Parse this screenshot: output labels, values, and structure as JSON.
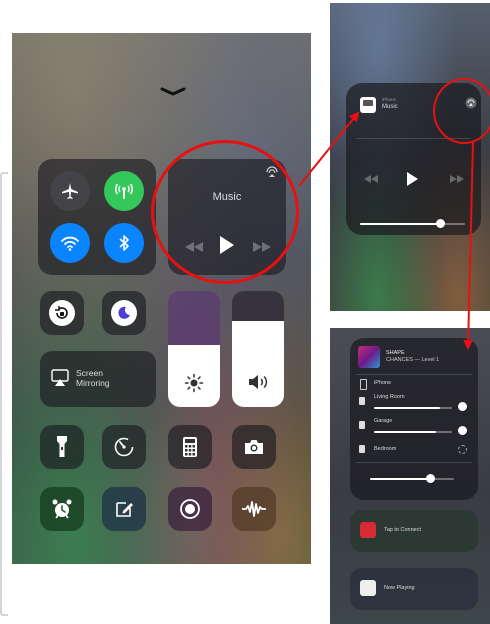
{
  "main": {
    "music_title": "Music",
    "screen_mirroring_label": "Screen\nMirroring"
  },
  "top_right": {
    "source_label": "iPhone",
    "track_label": "Music"
  },
  "bottom_right": {
    "track_title": "SHAPE",
    "track_artist": "CHANCES — Level 1",
    "devices": [
      {
        "name": "iPhone"
      },
      {
        "name": "Living Room"
      },
      {
        "name": "Garage"
      },
      {
        "name": "Bedroom"
      }
    ],
    "connect_label": "Tap to Connect",
    "now_playing_label": "Now Playing"
  },
  "colors": {
    "annotation": "#e81010",
    "airplane_active": "#ff9f0a",
    "cellular_active": "#34c759",
    "wifi_bluetooth_active": "#0a84ff"
  }
}
